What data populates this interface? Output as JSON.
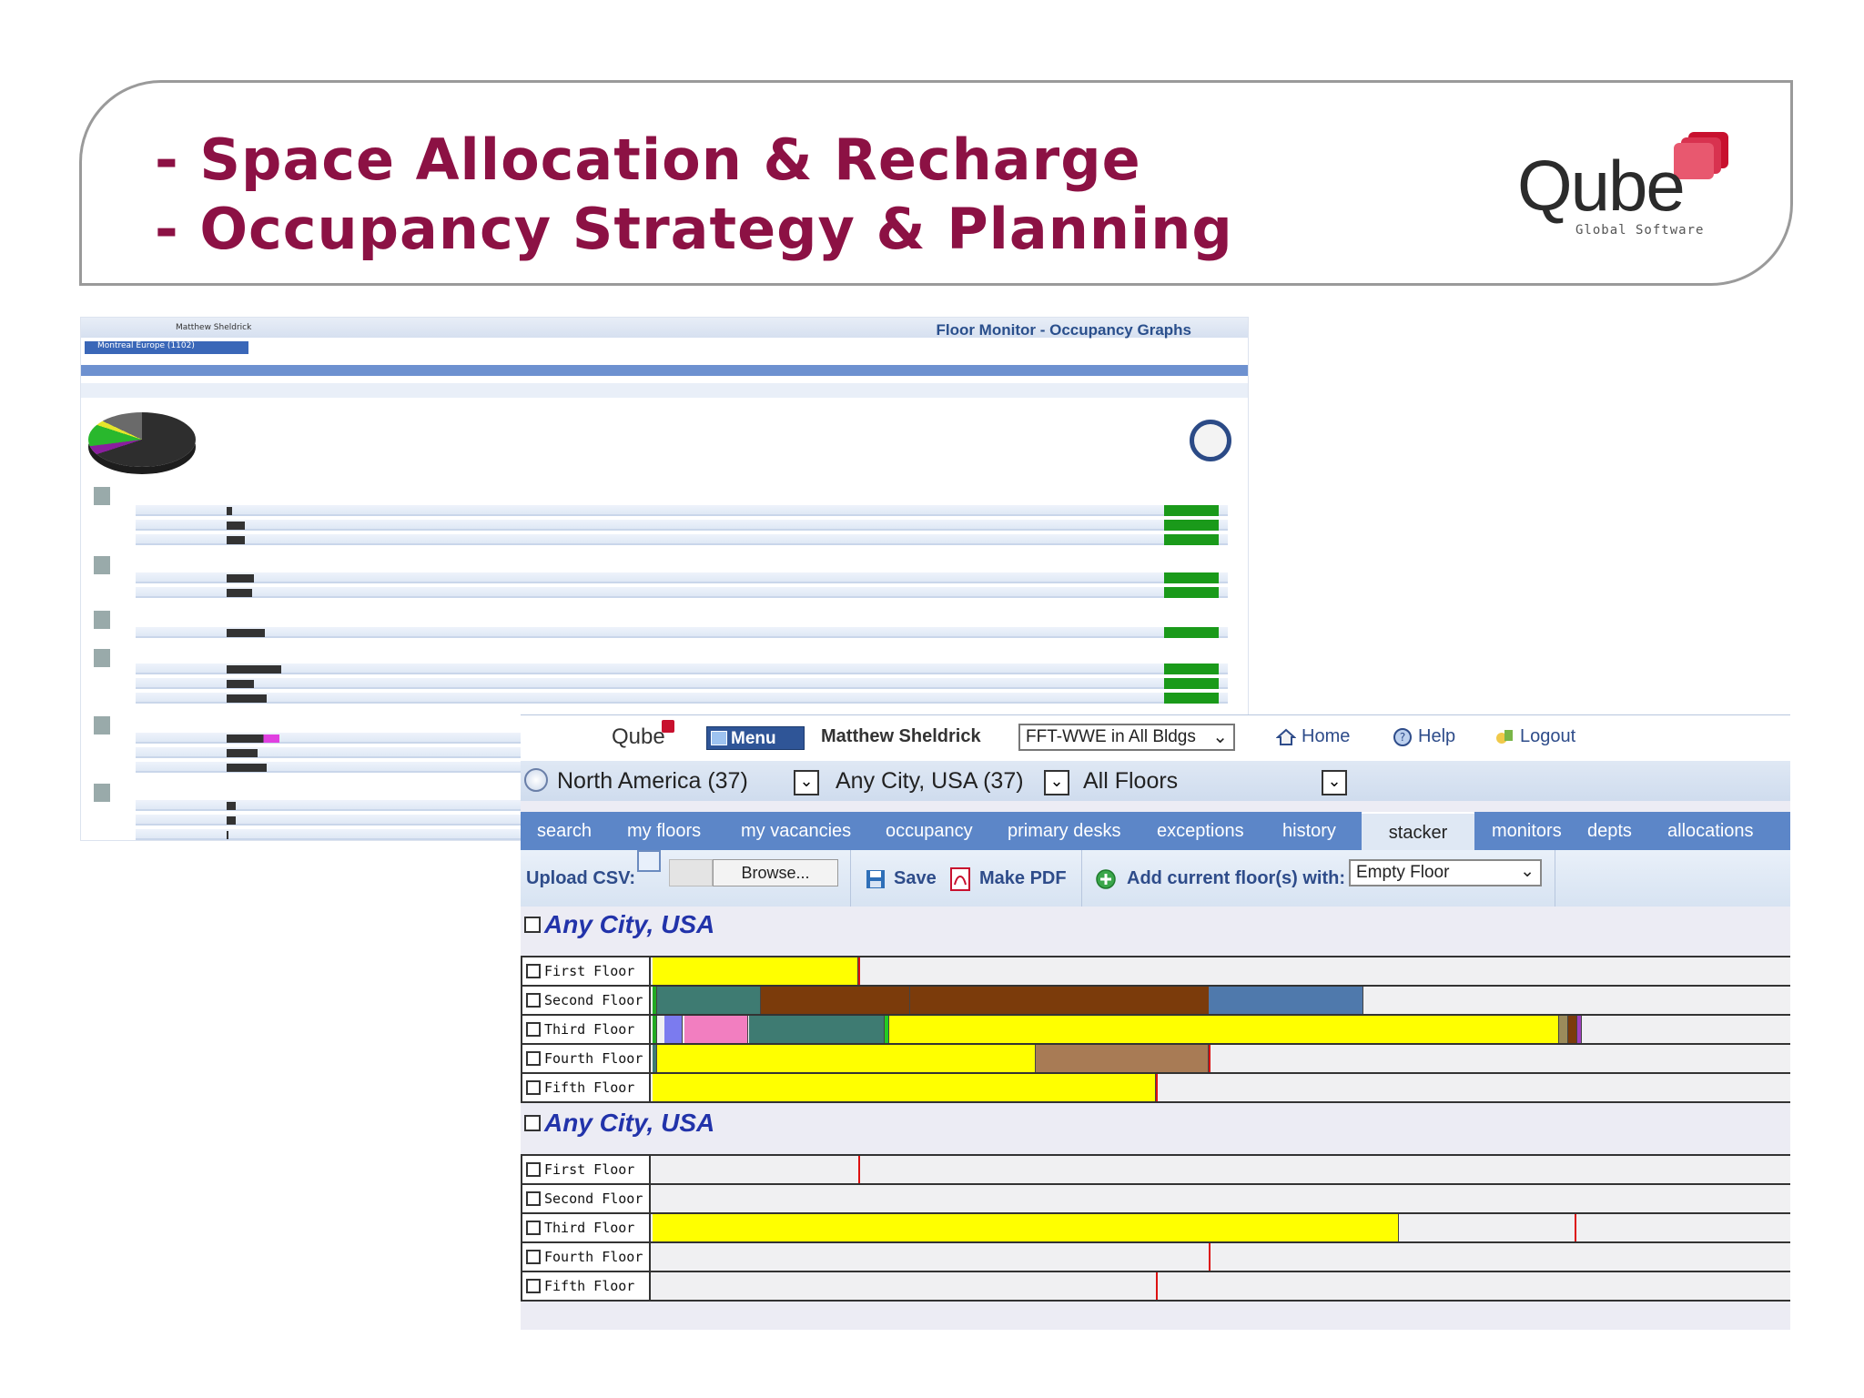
{
  "slide": {
    "title_line1": "- Space Allocation & Recharge",
    "title_line2": "- Occupancy Strategy & Planning",
    "logo_text": "Qube",
    "logo_sub": "Global Software",
    "brand_color": "#8c1144"
  },
  "back_screenshot": {
    "title": "Floor Monitor - Occupancy Graphs",
    "user": "Matthew Sheldrick",
    "region": "Montreal Europe (1102)"
  },
  "front": {
    "header": {
      "logo": "Qube",
      "menu_label": "Menu",
      "user": "Matthew Sheldrick",
      "site_select": "FFT-WWE in All Bldgs",
      "home": "Home",
      "help": "Help",
      "logout": "Logout"
    },
    "selectors": {
      "region": "North America (37)",
      "city": "Any City, USA (37)",
      "floors": "All Floors"
    },
    "tabs": [
      "search",
      "my floors",
      "my vacancies",
      "occupancy",
      "primary desks",
      "exceptions",
      "history",
      "stacker",
      "monitors",
      "depts",
      "allocations"
    ],
    "active_tab": "stacker",
    "toolbar": {
      "upload_csv": "Upload CSV:",
      "browse": "Browse...",
      "save": "Save",
      "make_pdf": "Make PDF",
      "add_floor": "Add current floor(s) with:",
      "fill_option": "Empty Floor"
    },
    "groups": [
      {
        "name": "Any City, USA",
        "floors": [
          {
            "name": "First Floor",
            "segments": [
              {
                "start": 0,
                "end": 0.181,
                "color": "#ffff00"
              }
            ],
            "marker": 0.181
          },
          {
            "name": "Second Floor",
            "segments": [
              {
                "start": 0,
                "end": 0.004,
                "color": "#22aa22"
              },
              {
                "start": 0.004,
                "end": 0.095,
                "color": "#3e7b72"
              },
              {
                "start": 0.095,
                "end": 0.226,
                "color": "#7b3b0b"
              },
              {
                "start": 0.226,
                "end": 0.489,
                "color": "#7b3b0b"
              },
              {
                "start": 0.489,
                "end": 0.625,
                "color": "#4f79ac"
              }
            ],
            "marker": null
          },
          {
            "name": "Third Floor",
            "segments": [
              {
                "start": 0,
                "end": 0.004,
                "color": "#22aa22"
              },
              {
                "start": 0.01,
                "end": 0.026,
                "color": "#7b7bef"
              },
              {
                "start": 0.028,
                "end": 0.084,
                "color": "#f27ec0"
              },
              {
                "start": 0.085,
                "end": 0.204,
                "color": "#3e7b72"
              },
              {
                "start": 0.204,
                "end": 0.208,
                "color": "#22cc22"
              },
              {
                "start": 0.208,
                "end": 0.797,
                "color": "#ffff00"
              },
              {
                "start": 0.797,
                "end": 0.805,
                "color": "#9b8b5b"
              },
              {
                "start": 0.805,
                "end": 0.813,
                "color": "#7b3b0b"
              },
              {
                "start": 0.813,
                "end": 0.817,
                "color": "#a040c0"
              }
            ],
            "marker": null
          },
          {
            "name": "Fourth Floor",
            "segments": [
              {
                "start": 0,
                "end": 0.004,
                "color": "#3e7b72"
              },
              {
                "start": 0.004,
                "end": 0.337,
                "color": "#ffff00"
              },
              {
                "start": 0.337,
                "end": 0.489,
                "color": "#a87b55"
              }
            ],
            "marker": 0.489
          },
          {
            "name": "Fifth Floor",
            "segments": [
              {
                "start": 0,
                "end": 0.442,
                "color": "#ffff00"
              }
            ],
            "marker": 0.442
          }
        ]
      },
      {
        "name": "Any City, USA",
        "floors": [
          {
            "name": "First Floor",
            "segments": [],
            "marker": 0.181
          },
          {
            "name": "Second Floor",
            "segments": [],
            "marker": null
          },
          {
            "name": "Third Floor",
            "segments": [
              {
                "start": 0,
                "end": 0.656,
                "color": "#ffff00"
              }
            ],
            "marker": 0.81
          },
          {
            "name": "Fourth Floor",
            "segments": [],
            "marker": 0.489
          },
          {
            "name": "Fifth Floor",
            "segments": [],
            "marker": 0.442
          }
        ]
      }
    ]
  }
}
